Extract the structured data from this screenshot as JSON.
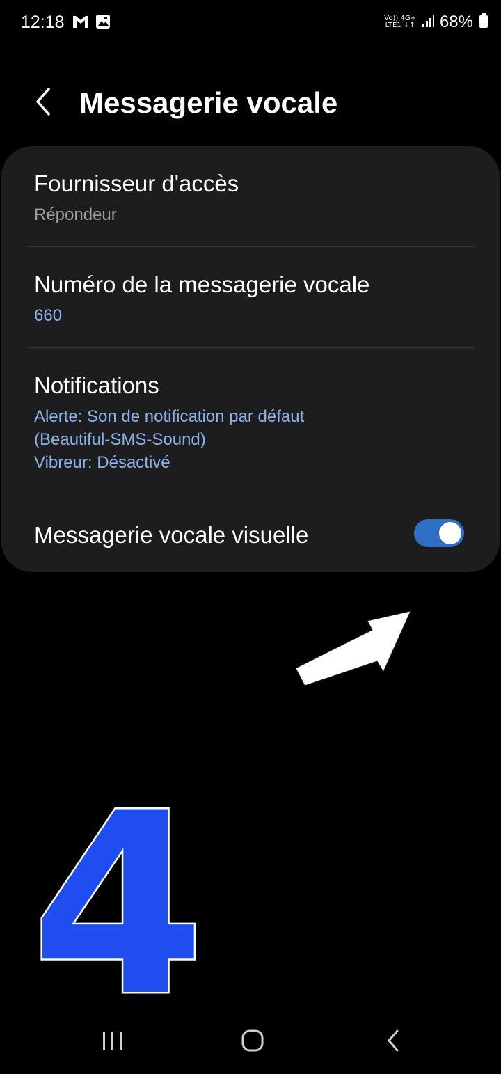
{
  "status_bar": {
    "time": "12:18",
    "left_icons": [
      "gmail-icon",
      "gallery-icon"
    ],
    "network_top": "Vo)) 4G+",
    "network_bottom": "LTE1 ↓↑",
    "battery": "68%",
    "right_icons": [
      "volte-icon",
      "4g-icon",
      "signal-icon",
      "battery-icon"
    ]
  },
  "header": {
    "title": "Messagerie vocale",
    "back_icon": "chevron-left-icon"
  },
  "settings": {
    "provider": {
      "title": "Fournisseur d'accès",
      "value": "Répondeur"
    },
    "voicemail_number": {
      "title": "Numéro de la messagerie vocale",
      "value": "660"
    },
    "notifications": {
      "title": "Notifications",
      "line1": "Alerte: Son de notification par défaut",
      "line2": "(Beautiful-SMS-Sound)",
      "line3": "Vibreur: Désactivé"
    },
    "visual_voicemail": {
      "title": "Messagerie vocale visuelle",
      "enabled": true
    }
  },
  "overlay": {
    "arrow_icon": "arrow-up-right-icon",
    "step_number": "4"
  },
  "nav_bar": {
    "icons": [
      "recent-apps-icon",
      "home-icon",
      "back-icon"
    ]
  },
  "colors": {
    "background": "#000000",
    "card": "#1d1d1f",
    "accent": "#2e6ec7",
    "link_text": "#8ab3e8",
    "secondary_text": "#9d9d9f",
    "step_number_fill": "#1f4df0"
  }
}
